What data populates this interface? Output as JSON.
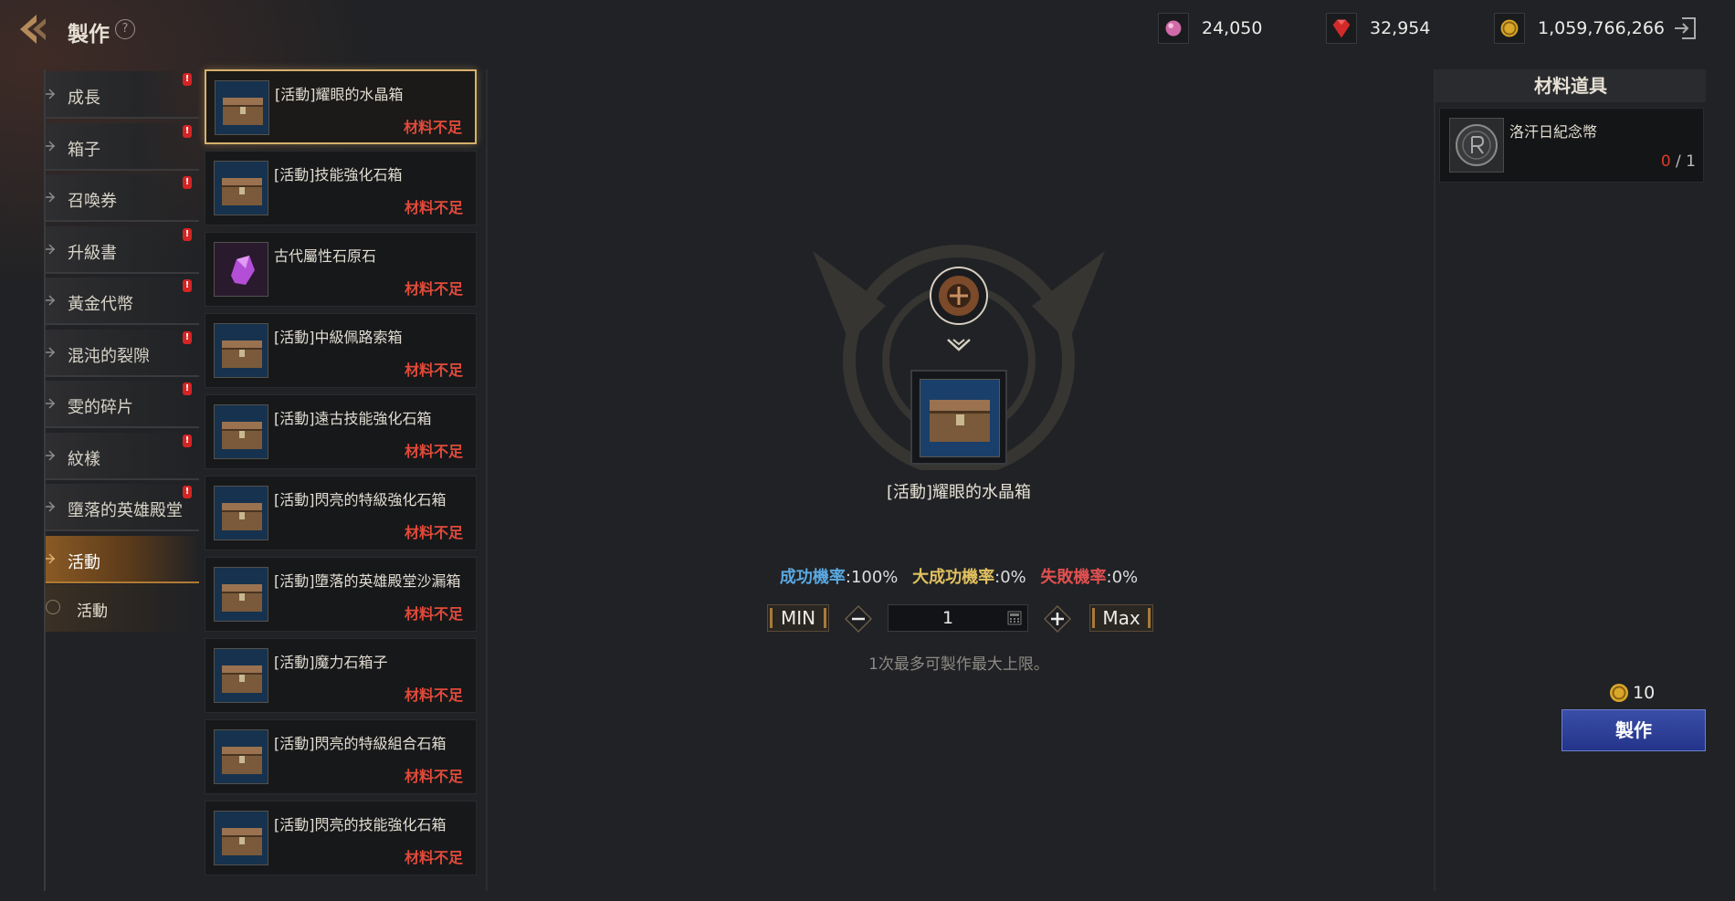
{
  "header": {
    "title": "製作",
    "help_glyph": "?",
    "currencies": [
      {
        "icon": "pink-gem-icon",
        "value": "24,050"
      },
      {
        "icon": "red-ruby-icon",
        "value": "32,954"
      },
      {
        "icon": "gold-coin-icon",
        "value": "1,059,766,266"
      }
    ]
  },
  "categories": [
    {
      "label": "成長",
      "alert": true
    },
    {
      "label": "箱子",
      "alert": true
    },
    {
      "label": "召喚券",
      "alert": true
    },
    {
      "label": "升級書",
      "alert": true
    },
    {
      "label": "黃金代幣",
      "alert": true
    },
    {
      "label": "混沌的裂隙",
      "alert": true
    },
    {
      "label": "雯的碎片",
      "alert": true
    },
    {
      "label": "紋樣",
      "alert": true
    },
    {
      "label": "墮落的英雄殿堂",
      "alert": true
    },
    {
      "label": "活動",
      "alert": false,
      "active": true
    }
  ],
  "subcategory": {
    "label": "活動"
  },
  "alert_glyph": "!",
  "items": [
    {
      "name": "[活動]耀眼的水晶箱",
      "status": "材料不足",
      "icon": "chest-icon",
      "selected": true
    },
    {
      "name": "[活動]技能強化石箱",
      "status": "材料不足",
      "icon": "chest-icon"
    },
    {
      "name": "古代屬性石原石",
      "status": "材料不足",
      "icon": "purple-crystal-icon"
    },
    {
      "name": "[活動]中級佩路索箱",
      "status": "材料不足",
      "icon": "chest-icon"
    },
    {
      "name": "[活動]遠古技能強化石箱",
      "status": "材料不足",
      "icon": "chest-icon"
    },
    {
      "name": "[活動]閃亮的特級強化石箱",
      "status": "材料不足",
      "icon": "chest-icon"
    },
    {
      "name": "[活動]墮落的英雄殿堂沙漏箱",
      "status": "材料不足",
      "icon": "chest-icon"
    },
    {
      "name": "[活動]魔力石箱子",
      "status": "材料不足",
      "icon": "chest-icon"
    },
    {
      "name": "[活動]閃亮的特級組合石箱",
      "status": "材料不足",
      "icon": "chest-icon"
    },
    {
      "name": "[活動]閃亮的技能強化石箱",
      "status": "材料不足",
      "icon": "chest-icon"
    }
  ],
  "result": {
    "name": "[活動]耀眼的水晶箱",
    "icon": "chest-icon"
  },
  "rates": {
    "success_label": "成功機率",
    "success_value": ":100%",
    "great_label": "大成功機率",
    "great_value": ":0%",
    "fail_label": "失敗機率",
    "fail_value": ":0%"
  },
  "quantity": {
    "min_label": "MIN",
    "max_label": "Max",
    "value": "1",
    "note": "1次最多可製作最大上限。"
  },
  "materials": {
    "header": "材料道具",
    "items": [
      {
        "name": "洛汗日紀念幣",
        "have": "0",
        "need": " / 1",
        "icon": "coin-medal-icon"
      }
    ]
  },
  "craft": {
    "cost": "10",
    "button_label": "製作"
  },
  "colors": {
    "accent_gold": "#d6b06a",
    "warning_red": "#e04a3a",
    "craft_blue": "#2c3e98",
    "success_blue": "#5aa8e0",
    "great_yellow": "#e0c060"
  }
}
